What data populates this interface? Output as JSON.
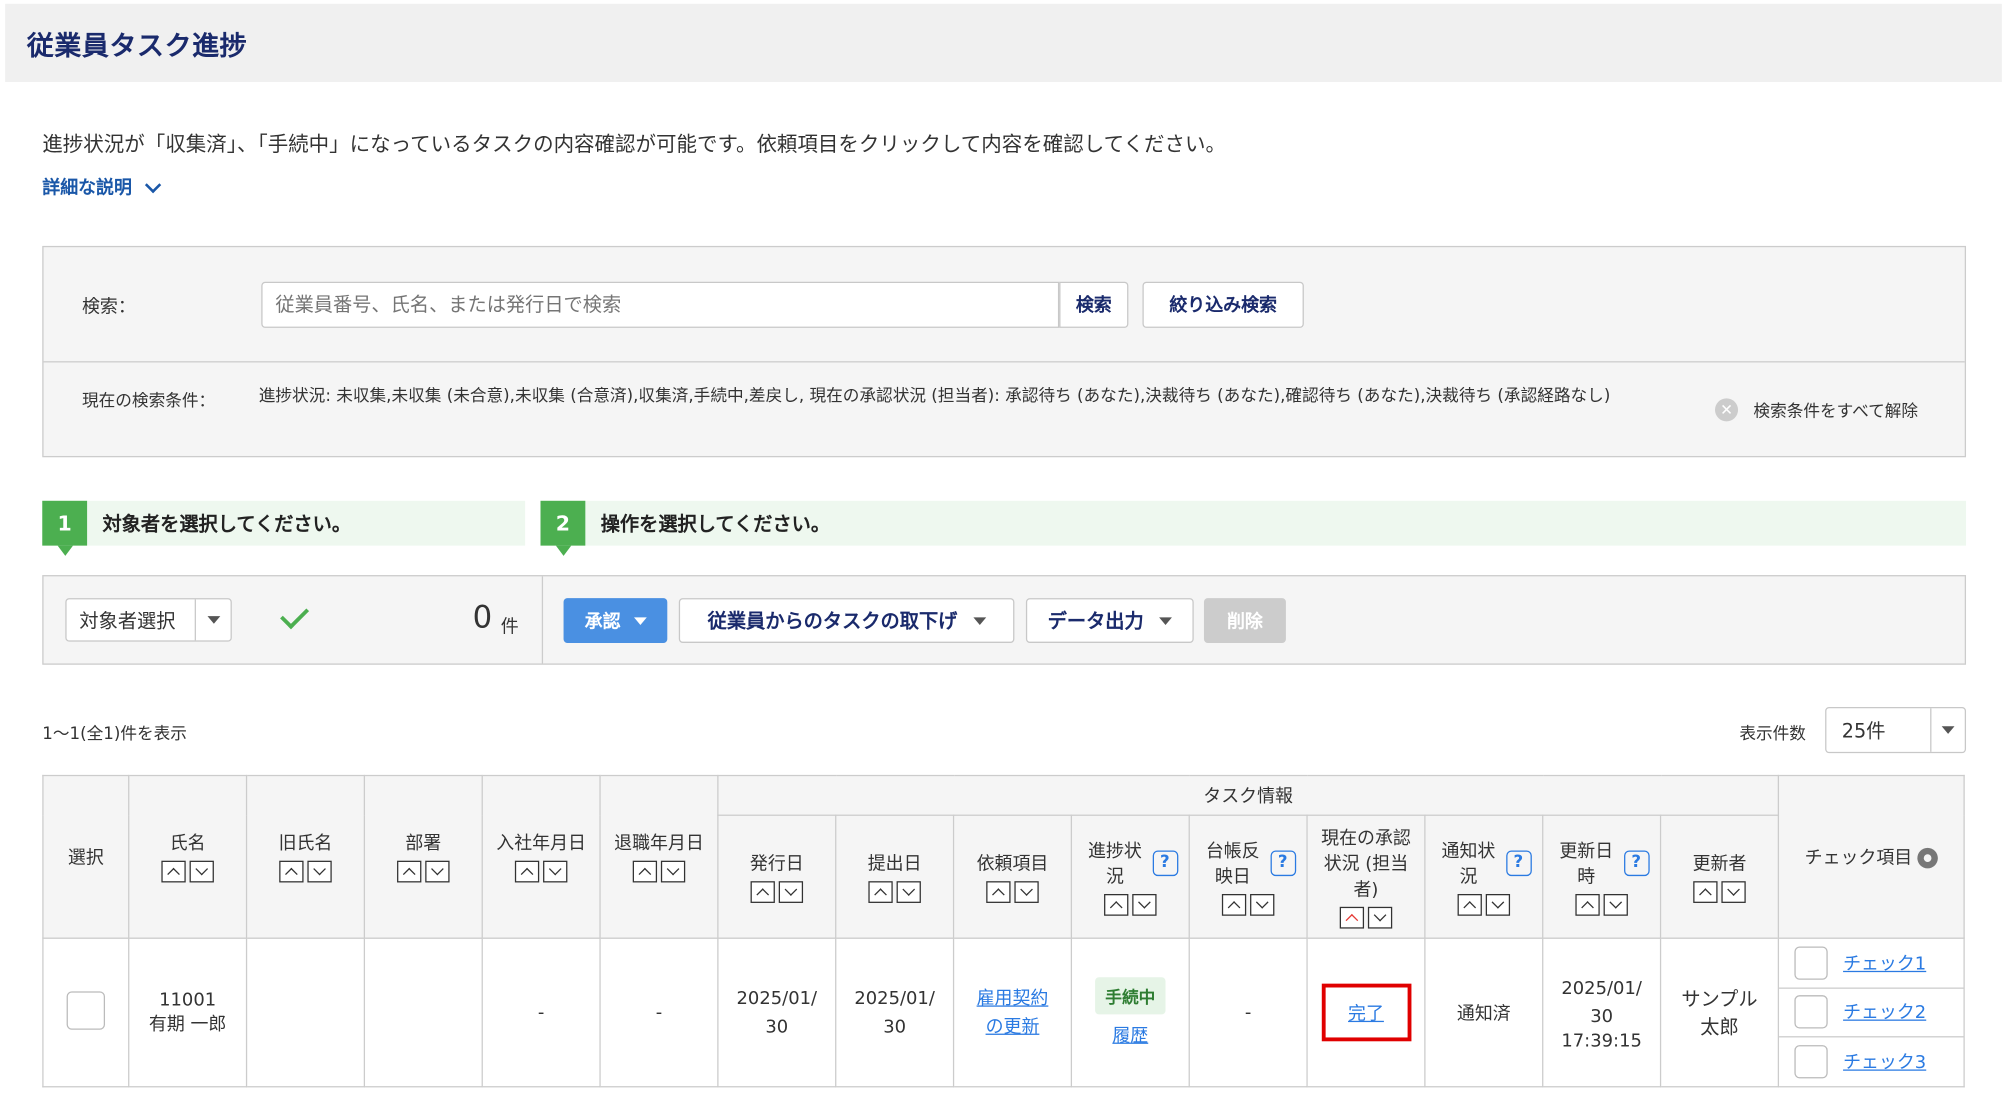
{
  "page": {
    "title": "従業員タスク進捗",
    "intro": "進捗状況が「収集済」、「手続中」になっているタスクの内容確認が可能です。依頼項目をクリックして内容を確認してください。",
    "detail_link": "詳細な説明"
  },
  "search": {
    "label": "検索：",
    "placeholder": "従業員番号、氏名、または発行日で検索",
    "search_button": "検索",
    "filter_button": "絞り込み検索",
    "conditions_label": "現在の検索条件：",
    "conditions_text": "進捗状況: 未収集,未収集 (未合意),未収集 (合意済),収集済,手続中,差戻し, 現在の承認状況 (担当者): 承認待ち (あなた),決裁待ち (あなた),確認待ち (あなた),決裁待ち (承認経路なし)",
    "clear_all": "検索条件をすべて解除"
  },
  "steps": [
    {
      "num": "1",
      "text": "対象者を選択してください。"
    },
    {
      "num": "2",
      "text": "操作を選択してください。"
    }
  ],
  "actions": {
    "target_select": "対象者選択",
    "count": "0",
    "count_unit": "件",
    "approve": "承認",
    "withdraw": "従業員からのタスクの取下げ",
    "export": "データ出力",
    "delete": "削除"
  },
  "listing": {
    "showing": "1〜1(全1)件を表示",
    "per_page_label": "表示件数",
    "per_page_value": "25件"
  },
  "table": {
    "headers": {
      "select": "選択",
      "name": "氏名",
      "old_name": "旧氏名",
      "dept": "部署",
      "join_date": "入社年月日",
      "leave_date": "退職年月日",
      "task_info": "タスク情報",
      "issue_date": "発行日",
      "submit_date": "提出日",
      "request_item": "依頼項目",
      "progress": "進捗状況",
      "ledger_date": "台帳反映日",
      "approval_status": "現在の承認状況 (担当者)",
      "notify_status": "通知状況",
      "updated_at": "更新日時",
      "updater": "更新者",
      "check_items": "チェック項目"
    },
    "row": {
      "emp_id": "11001",
      "emp_name": "有期 一郎",
      "old_name": "",
      "dept": "",
      "join_date": "-",
      "leave_date": "-",
      "issue_date": "2025/01/30",
      "submit_date": "2025/01/30",
      "request_item": "雇用契約の更新",
      "progress_badge": "手続中",
      "history_link": "履歴",
      "ledger_date": "-",
      "approval_status": "完了",
      "notify_status": "通知済",
      "updated_date": "2025/01/30",
      "updated_time": "17:39:15",
      "updater": "サンプル 太郎",
      "checks": [
        "チェック1",
        "チェック2",
        "チェック3"
      ]
    }
  }
}
